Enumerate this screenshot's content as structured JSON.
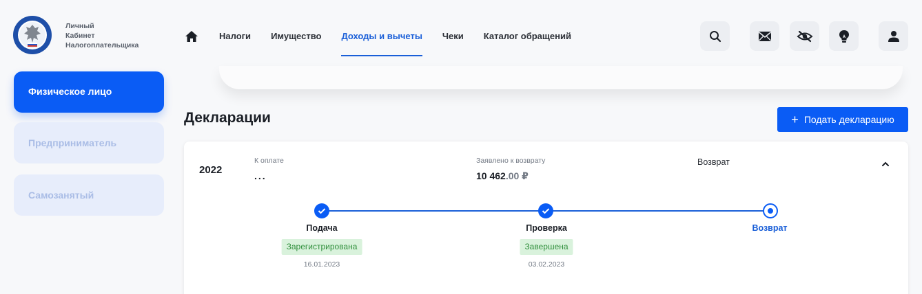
{
  "brand": {
    "line1": "Личный",
    "line2": "Кабинет",
    "line3": "Налогоплательщика",
    "logo_text": "ФЕДЕРАЛЬНАЯ НАЛОГОВАЯ СЛУЖБА"
  },
  "nav": {
    "home_icon": "home-icon",
    "items": [
      {
        "label": "Налоги"
      },
      {
        "label": "Имущество"
      },
      {
        "label": "Доходы и вычеты",
        "active": true
      },
      {
        "label": "Чеки"
      },
      {
        "label": "Каталог обращений"
      }
    ]
  },
  "toolbar": {
    "icons": [
      "search-icon",
      "mail-icon",
      "eye-off-icon",
      "lightbulb-icon",
      "user-icon"
    ]
  },
  "sidebar": {
    "items": [
      {
        "label": "Физическое лицо",
        "active": true
      },
      {
        "label": "Предприниматель"
      },
      {
        "label": "Самозанятый"
      }
    ]
  },
  "main": {
    "title": "Декларации",
    "submit_button": "Подать декларацию",
    "submit_icon": "+"
  },
  "declaration": {
    "year": "2022",
    "to_pay_label": "К оплате",
    "to_pay_value": "...",
    "refund_label": "Заявлено к возврату",
    "refund_int": "10 462",
    "refund_dec": ".00 ₽",
    "status_header": "Возврат",
    "steps": [
      {
        "label": "Подача",
        "badge": "Зарегистрирована",
        "date": "16.01.2023",
        "state": "done"
      },
      {
        "label": "Проверка",
        "badge": "Завершена",
        "date": "03.02.2023",
        "state": "done"
      },
      {
        "label": "Возврат",
        "state": "current"
      }
    ]
  },
  "colors": {
    "accent": "#0a5cf5",
    "nav_active": "#1a5fd8",
    "badge_bg": "#d9f2dc",
    "badge_text": "#2f8f3b",
    "sidebar_inactive_bg": "#e7edfb",
    "sidebar_inactive_text": "#aabde6"
  }
}
